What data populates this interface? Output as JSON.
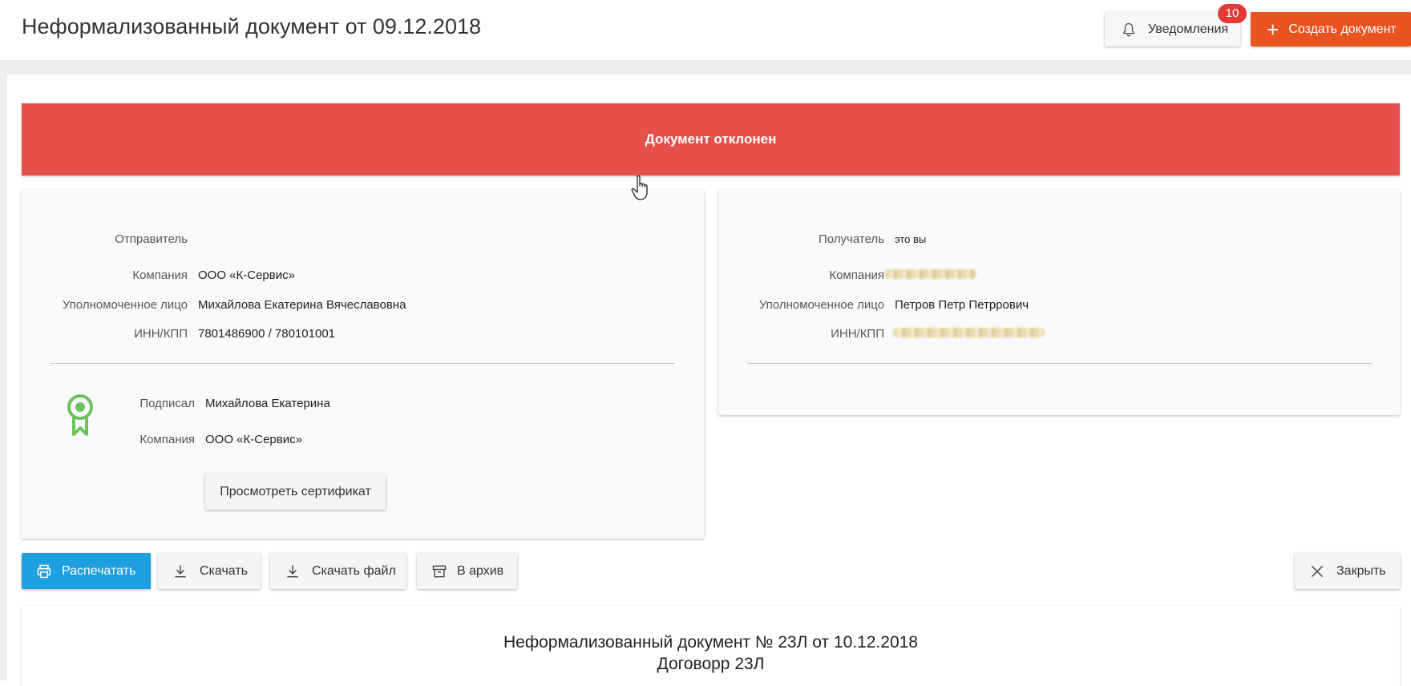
{
  "header": {
    "title": "Неформализованный документ от 09.12.2018",
    "notifications_label": "Уведомления",
    "notifications_count": "10",
    "create_label": "Создать документ"
  },
  "status": {
    "text": "Документ отклонен",
    "color": "#e5504b"
  },
  "sender": {
    "heading": "Отправитель",
    "company_label": "Компания",
    "company": "ООО «К-Сервис»",
    "authorized_label": "Уполномоченное лицо",
    "authorized": "Михайлова Екатерина Вячеславовна",
    "inn_label": "ИНН/КПП",
    "inn": "7801486900 / 780101001",
    "signed_label": "Подписал",
    "signed": "Михайлова Екатерина",
    "sign_company_label": "Компания",
    "sign_company": "ООО «К-Сервис»",
    "certificate_button": "Просмотреть сертификат"
  },
  "recipient": {
    "heading": "Получатель",
    "heading_note": "это вы",
    "company_label": "Компания",
    "authorized_label": "Уполномоченное лицо",
    "authorized": "Петров Петр Петррович",
    "inn_label": "ИНН/КПП"
  },
  "actions": {
    "print": "Распечатать",
    "download": "Скачать",
    "download_file": "Скачать файл",
    "archive": "В архив",
    "close": "Закрыть"
  },
  "document": {
    "line1": "Неформализованный документ № 23Л от 10.12.2018",
    "line2": "Договорр 23Л"
  },
  "colors": {
    "primary_orange": "#e9531f",
    "print_blue": "#1e9fe0",
    "badge_red": "#e53935",
    "cert_green": "#6cc35c"
  }
}
